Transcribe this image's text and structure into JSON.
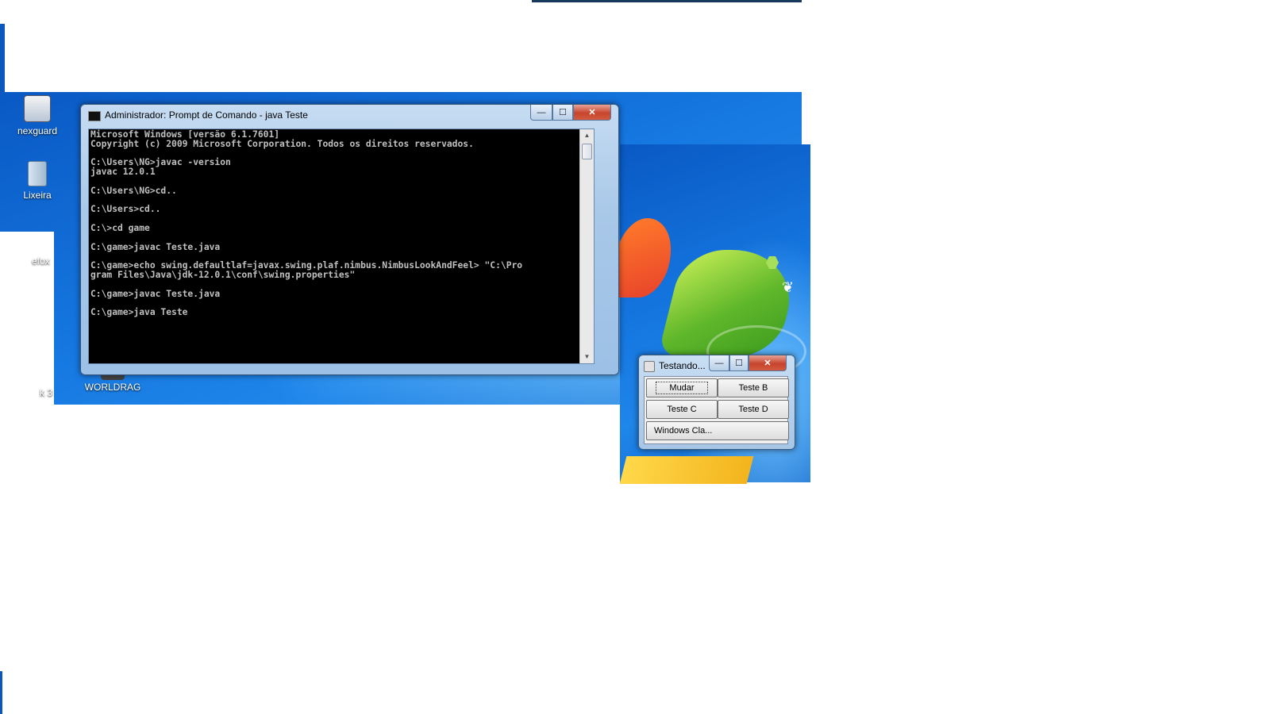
{
  "desktop": {
    "icons": [
      {
        "label": "nexguard"
      },
      {
        "label": "Lixeira"
      },
      {
        "label": "efox"
      },
      {
        "label": "k 3"
      },
      {
        "label": "WORLDRAG"
      }
    ]
  },
  "console_window": {
    "title": "Administrador: Prompt de Comando - java  Teste",
    "buttons": {
      "minimize": "—",
      "maximize": "☐",
      "close": "✕"
    },
    "lines": [
      "Microsoft Windows [versão 6.1.7601]",
      "Copyright (c) 2009 Microsoft Corporation. Todos os direitos reservados.",
      "",
      "C:\\Users\\NG>javac -version",
      "javac 12.0.1",
      "",
      "C:\\Users\\NG>cd..",
      "",
      "C:\\Users>cd..",
      "",
      "C:\\>cd game",
      "",
      "C:\\game>javac Teste.java",
      "",
      "C:\\game>echo swing.defaultlaf=javax.swing.plaf.nimbus.NimbusLookAndFeel> \"C:\\Pro",
      "gram Files\\Java\\jdk-12.0.1\\conf\\swing.properties\"",
      "",
      "C:\\game>javac Teste.java",
      "",
      "C:\\game>java Teste"
    ]
  },
  "java_window": {
    "title": "Testando...",
    "buttons": {
      "mudar": "Mudar",
      "teste_b": "Teste B",
      "teste_c": "Teste C",
      "teste_d": "Teste D",
      "windows_classic": "Windows Cla..."
    }
  }
}
